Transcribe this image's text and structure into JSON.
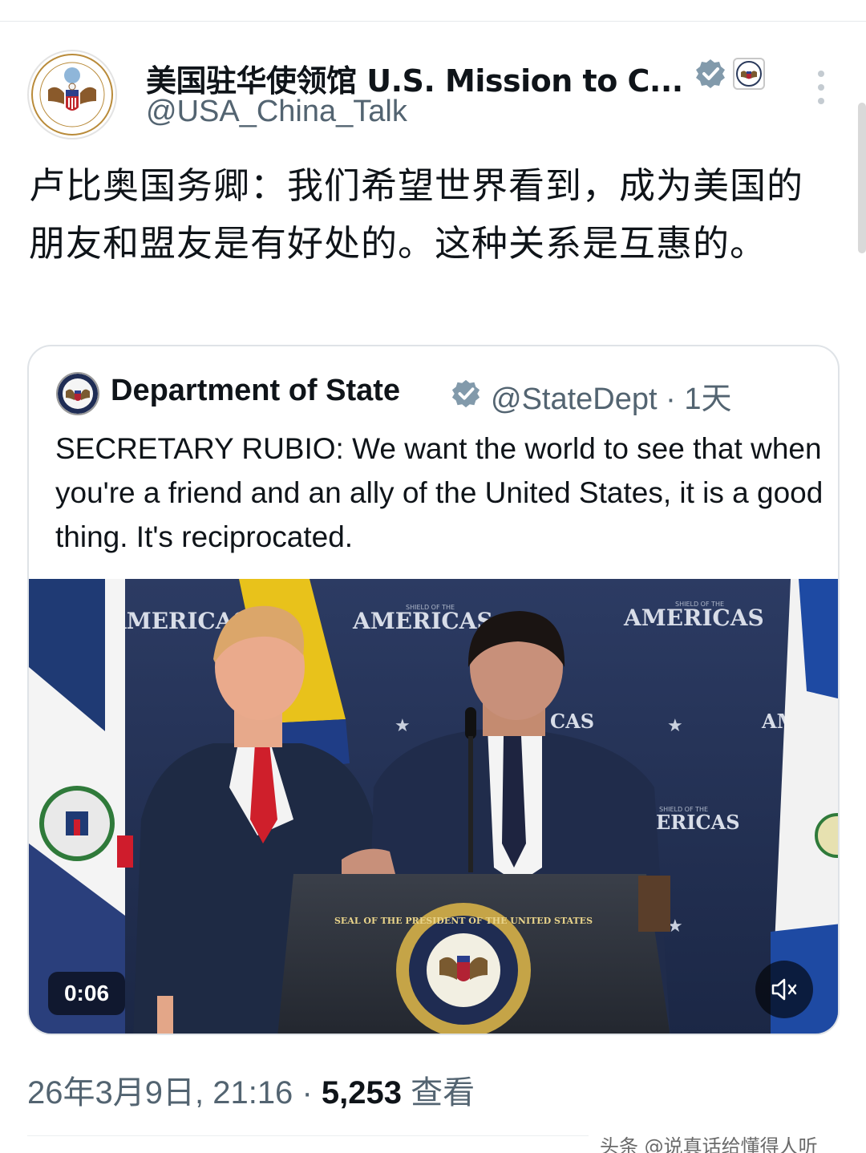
{
  "tweet": {
    "display_name": "美国驻华使领馆 U.S. Mission to C...",
    "handle": "@USA_China_Talk",
    "text": "卢比奥国务卿：我们希望世界看到，成为美国的朋友和盟友是有好处的。这种关系是互惠的。",
    "date_time": "26年3月9日, 21:16",
    "separator": "·",
    "views_count": "5,253",
    "views_label": "查看"
  },
  "quote": {
    "display_name": "Department of State",
    "handle_time": "@StateDept · 1天",
    "text": "SECRETARY RUBIO: We want the world to see that when you're a friend and an ally of the United States, it is a good thing. It's reciprocated.",
    "video": {
      "duration": "0:06",
      "backdrop_text": [
        "AMERICAS",
        "AMERICAS",
        "AMERICAS",
        "ERICAS",
        "ERICAS",
        "CAS",
        "AM"
      ],
      "backdrop_subtext": [
        "SHIELD OF THE",
        "SHIELD OF THE",
        "SHIELD OF THE"
      ],
      "seal_text": "SEAL OF THE PRESIDENT OF THE UNITED STATES"
    }
  },
  "watermark": "头条 @说真话给懂得人听",
  "icons": {
    "verified": "verified-badge-icon",
    "affiliate": "us-seal-icon",
    "more": "more-options-icon",
    "mute": "mute-icon"
  },
  "colors": {
    "verified_gray": "#829aab",
    "handle_gray": "#536471",
    "text": "#0f1419"
  }
}
